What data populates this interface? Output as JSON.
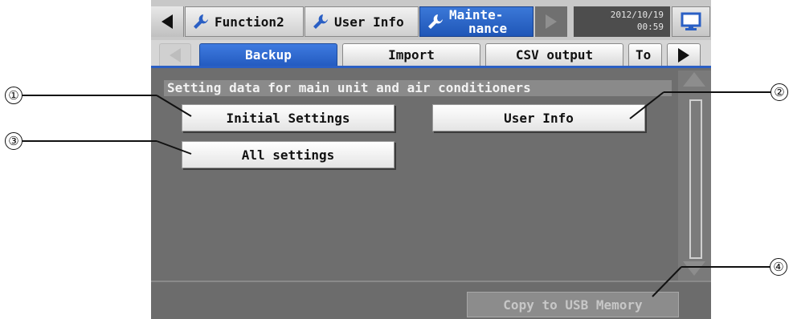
{
  "topbar": {
    "tabs": [
      {
        "label": "Function2",
        "icon": "wrench-icon"
      },
      {
        "label": "User Info",
        "icon": "wrench-icon"
      },
      {
        "label_line1": "Mainte-",
        "label_line2": "nance",
        "icon": "wrench-icon",
        "active": true
      }
    ],
    "date": "2012/10/19",
    "time": "00:59",
    "icons": {
      "left": "left-arrow-icon",
      "right": "right-arrow-icon",
      "monitor": "monitor-icon"
    },
    "accent_color": "#2a5fc4"
  },
  "subtabs": {
    "items": [
      "Backup",
      "Import",
      "CSV output",
      "To"
    ],
    "active": "Backup"
  },
  "main": {
    "section_title": "Setting data for main unit and air conditioners",
    "buttons": {
      "initial_settings": "Initial Settings",
      "user_info": "User Info",
      "all_settings": "All settings"
    }
  },
  "footer": {
    "usb_button": "Copy to USB Memory"
  },
  "callouts": [
    "①",
    "②",
    "③",
    "④"
  ]
}
